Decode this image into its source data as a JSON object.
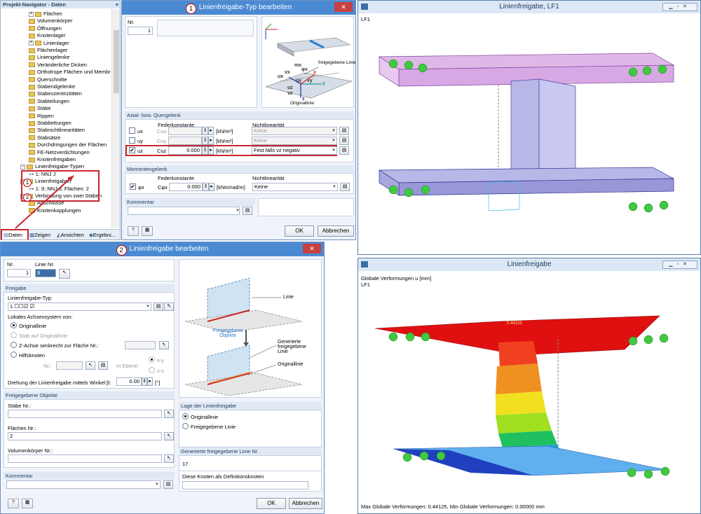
{
  "navigator": {
    "title": "Projekt-Navigator - Daten",
    "close": "×",
    "items": [
      "Flächen",
      "Volumenkörper",
      "Öffnungen",
      "Knotenlager",
      "Linienlager",
      "Flächenlager",
      "Liniengelenke",
      "Veränderliche Dicken",
      "Orthotrope Flächen und Membr",
      "Querschnitte",
      "Stabendgelenke",
      "Stabexzentrizitäten",
      "Stabteilungen",
      "Stäbe",
      "Rippen",
      "Stabbettungen",
      "Stabnichtlinearitäten",
      "Stabsätze",
      "Durchdringungen der Flächen",
      "FE-Netzverdichtungen",
      "Knotenfreigaben",
      "Linienfreigabe-Typen",
      "1: NNJ J",
      "Linienfreigaben",
      "1: 9; NNJ J; Flächen: 2",
      "Verbindung von zwei Stäben",
      "Anschlüsse",
      "Knotenkopplungen"
    ],
    "tabs": [
      "Daten",
      "Zeigen",
      "Ansichten",
      "Ergebni..."
    ]
  },
  "dlg1": {
    "title": "Linienfreigabe-Typ bearbeiten",
    "callout": "1",
    "nr_label": "Nr.",
    "nr": "1",
    "sec_axial": "Axial- bzw. Quergelenk",
    "federkonstante": "Federkonstante",
    "nichtlinearitaet": "Nichtlinearität",
    "rows": [
      {
        "dof": "ux",
        "c": "Cux",
        "val": "",
        "unit": "[kN/m²]",
        "nl": "Keine",
        "checked": ""
      },
      {
        "dof": "uy",
        "c": "Cuy",
        "val": "",
        "unit": "[kN/m²]",
        "nl": "Keine",
        "checked": ""
      },
      {
        "dof": "uz",
        "c": "Cuz",
        "val": "0.000",
        "unit": "[kN/m²]",
        "nl": "Fest falls vz negativ",
        "checked": "✔"
      }
    ],
    "sec_moment": "Momentengelenk",
    "mrow": {
      "dof": "φx",
      "c": "Cφx",
      "val": "0.000",
      "unit": "[kNm/rad/m]",
      "nl": "Keine",
      "checked": "✔"
    },
    "kommentar": "Kommentar",
    "ok": "OK",
    "cancel": "Abbrechen",
    "diag": {
      "freigegebene_linie": "freigegebene Linie",
      "originallinie": "Originallinie",
      "z": "z",
      "y": "y",
      "x": "x",
      "phi": "φx",
      "mx": "mx",
      "ux": "ux",
      "uy": "uy",
      "uz": "uz",
      "vx": "vx",
      "vy": "vy",
      "vz": "vz"
    }
  },
  "dlg2": {
    "title": "Linienfreigabe bearbeiten",
    "callout": "2",
    "nr_label": "Nr.",
    "nr": "1",
    "linie_nr_label": "Linie Nr.",
    "linie_nr": "9",
    "sec_freigabe": "Freigabe",
    "typ_label": "Linienfreigabe-Typ:",
    "typ_value": "1",
    "typ_glyphs": "☐☐☑ ☑",
    "achs_label": "Lokales Achsensystem von:",
    "r_original": "Originallinie",
    "r_stab": "Stab auf Originallinie",
    "r_zachse": "Z-Achse senkrecht zur Fläche Nr.:",
    "r_hilf": "Hilfsknoten",
    "nr_sub": "Nr.:",
    "in_ebene": "In Ebene:",
    "xy": "x-y",
    "xz": "x-z",
    "drehung": "Drehung der Linienfreigabe mittels Winkel",
    "beta": "β:",
    "beta_val": "0.00",
    "deg": "[°]",
    "sec_objekte": "Freigegebene Objekte",
    "staebe": "Stäbe Nr.:",
    "flaechen": "Flächen Nr.:",
    "flaechen_val": "2",
    "volumen": "Volumenkörper Nr.:",
    "kommentar": "Kommentar",
    "sec_lage": "Lage der Linienfreigabe",
    "lage_original": "Originallinie",
    "lage_freigeg": "Freigegebene Linie",
    "sec_generiert": "Generierte freigegebene Linie Nr.",
    "generiert_val": "17",
    "knoten": "Diese Knoten als Definitionsknoten",
    "ok": "OK",
    "cancel": "Abbrechen",
    "diag": {
      "linie": "Linie",
      "freigeg_objekte": "Freigegebene Objekte",
      "generiert": "Generierte freigegebene Linie",
      "originallinie": "Originallinie"
    }
  },
  "win1": {
    "title": "Linienfreigabe, LF1",
    "lf": "LF1"
  },
  "win2": {
    "title": "Linienfreigabe",
    "line1": "Globale Verformungen u [mm]",
    "lf": "LF1",
    "footer": "Max Globale Verformungen: 0.44125, Min Globale Verformungen: 0.00000 mm",
    "maxlabel": "0.44125"
  },
  "colors": {
    "accent": "#4a8ad2",
    "highlight": "#c8282f"
  }
}
